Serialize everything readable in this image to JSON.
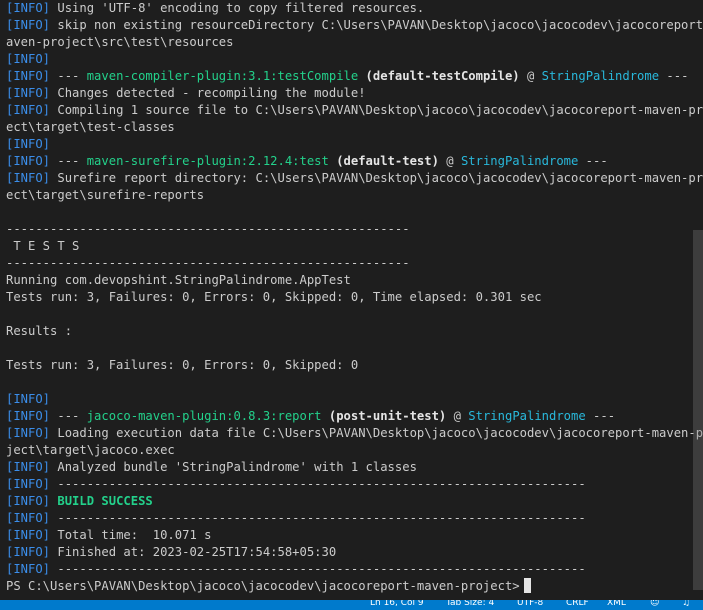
{
  "terminal": {
    "lines": [
      {
        "tag": "[INFO]",
        "text": " Using 'UTF-8' encoding to copy filtered resources."
      },
      {
        "tag": "[INFO]",
        "text": " skip non existing resourceDirectory C:\\Users\\PAVAN\\Desktop\\jacoco\\jacocodev\\jacocoreport-m"
      },
      {
        "text": "aven-project\\src\\test\\resources"
      },
      {
        "tag": "[INFO]"
      },
      {
        "tag": "[INFO]",
        "pre": " --- ",
        "plugin": "maven-compiler-plugin:3.1:testCompile",
        "goal": " (default-testCompile)",
        "at": " @ ",
        "project": "StringPalindrome",
        "post": " ---"
      },
      {
        "tag": "[INFO]",
        "text": " Changes detected - recompiling the module!"
      },
      {
        "tag": "[INFO]",
        "text": " Compiling 1 source file to C:\\Users\\PAVAN\\Desktop\\jacoco\\jacocodev\\jacocoreport-maven-proj"
      },
      {
        "text": "ect\\target\\test-classes"
      },
      {
        "tag": "[INFO]"
      },
      {
        "tag": "[INFO]",
        "pre": " --- ",
        "plugin": "maven-surefire-plugin:2.12.4:test",
        "goal": " (default-test)",
        "at": " @ ",
        "project": "StringPalindrome",
        "post": " ---"
      },
      {
        "tag": "[INFO]",
        "text": " Surefire report directory: C:\\Users\\PAVAN\\Desktop\\jacoco\\jacocodev\\jacocoreport-maven-proj"
      },
      {
        "text": "ect\\target\\surefire-reports"
      },
      {
        "text": ""
      },
      {
        "text": "-------------------------------------------------------"
      },
      {
        "text": " T E S T S"
      },
      {
        "text": "-------------------------------------------------------"
      },
      {
        "text": "Running com.devopshint.StringPalindrome.AppTest"
      },
      {
        "text": "Tests run: 3, Failures: 0, Errors: 0, Skipped: 0, Time elapsed: 0.301 sec"
      },
      {
        "text": ""
      },
      {
        "text": "Results :"
      },
      {
        "text": ""
      },
      {
        "text": "Tests run: 3, Failures: 0, Errors: 0, Skipped: 0"
      },
      {
        "text": ""
      },
      {
        "tag": "[INFO]"
      },
      {
        "tag": "[INFO]",
        "pre": " --- ",
        "plugin": "jacoco-maven-plugin:0.8.3:report",
        "goal": " (post-unit-test)",
        "at": " @ ",
        "project": "StringPalindrome",
        "post": " ---"
      },
      {
        "tag": "[INFO]",
        "text": " Loading execution data file C:\\Users\\PAVAN\\Desktop\\jacoco\\jacocodev\\jacocoreport-maven-pro"
      },
      {
        "text": "ject\\target\\jacoco.exec"
      },
      {
        "tag": "[INFO]",
        "text": " Analyzed bundle 'StringPalindrome' with 1 classes"
      },
      {
        "tag": "[INFO]",
        "text": " ------------------------------------------------------------------------"
      },
      {
        "tag": "[INFO]",
        "success": " BUILD SUCCESS"
      },
      {
        "tag": "[INFO]",
        "text": " ------------------------------------------------------------------------"
      },
      {
        "tag": "[INFO]",
        "text": " Total time:  10.071 s"
      },
      {
        "tag": "[INFO]",
        "text": " Finished at: 2023-02-25T17:54:58+05:30"
      },
      {
        "tag": "[INFO]",
        "text": " ------------------------------------------------------------------------"
      },
      {
        "text": "PS C:\\Users\\PAVAN\\Desktop\\jacoco\\jacocodev\\jacocoreport-maven-project>",
        "prompt": true
      }
    ]
  },
  "statusbar": {
    "items": [
      "Ln 16, Col 9",
      "Tab Size: 4",
      "UTF-8",
      "CRLF",
      "XML"
    ]
  }
}
